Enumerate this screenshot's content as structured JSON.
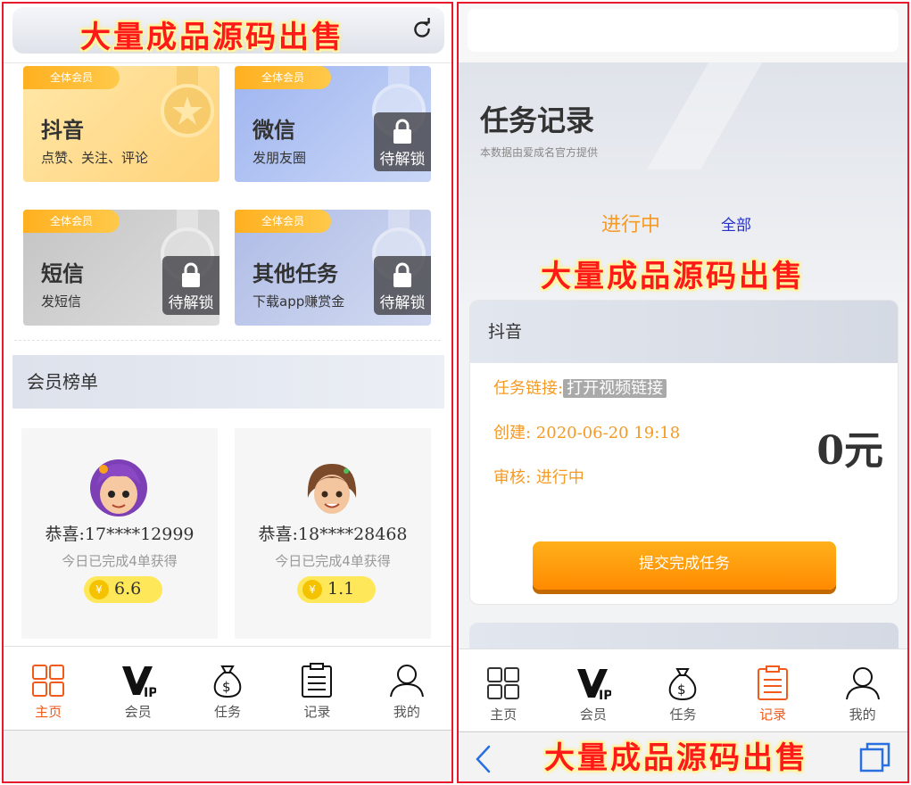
{
  "watermark": "大量成品源码出售",
  "left": {
    "cards": [
      {
        "tag": "全体会员",
        "title": "抖音",
        "sub": "点赞、关注、评论",
        "locked": false
      },
      {
        "tag": "全体会员",
        "title": "微信",
        "sub": "发朋友圈",
        "locked": true
      },
      {
        "tag": "全体会员",
        "title": "短信",
        "sub": "发短信",
        "locked": true
      },
      {
        "tag": "全体会员",
        "title": "其他任务",
        "sub": "下载app赚赏金",
        "locked": true
      }
    ],
    "lock_label": "待解锁",
    "section_title": "会员榜单",
    "members": [
      {
        "name": "恭喜:17****12999",
        "desc": "今日已完成4单获得",
        "amount": "6.6"
      },
      {
        "name": "恭喜:18****28468",
        "desc": "今日已完成4单获得",
        "amount": "1.1"
      }
    ],
    "coin_symbol": "¥"
  },
  "nav": {
    "items": [
      {
        "label": "主页",
        "icon": "home-grid-icon"
      },
      {
        "label": "会员",
        "icon": "vip-icon"
      },
      {
        "label": "任务",
        "icon": "money-bag-icon"
      },
      {
        "label": "记录",
        "icon": "clipboard-icon"
      },
      {
        "label": "我的",
        "icon": "user-icon"
      }
    ],
    "active_color": "#f05a1a"
  },
  "right": {
    "title": "任务记录",
    "subtitle": "本数据由爱成名官方提供",
    "tab_active": "进行中",
    "tab_all": "全部",
    "task": {
      "platform": "抖音",
      "link_label": "任务链接:",
      "link_text": "打开视频链接",
      "created": "创建: 2020-06-20 19:18",
      "review": "审核: 进行中",
      "amount": "0元",
      "submit": "提交完成任务"
    }
  },
  "colors": {
    "accent": "#f59a23",
    "banner": "#ff1a1a",
    "frame": "#e8192c",
    "link_blue": "#2430c8"
  }
}
